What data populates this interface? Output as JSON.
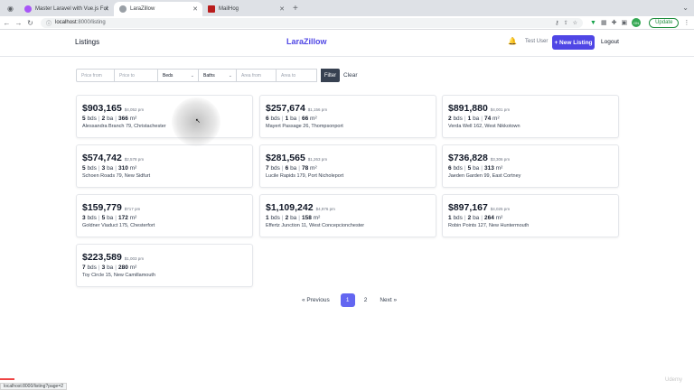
{
  "browser": {
    "tabs": [
      {
        "label": "Master Laravel with Vue.js Ful",
        "color": "#a855f7",
        "active": false
      },
      {
        "label": "LaraZillow",
        "color": "#5f6368",
        "active": true
      },
      {
        "label": "MailHog",
        "color": "#b91c1c",
        "active": false
      }
    ],
    "new_tab": "+",
    "url_host": "localhost",
    "url_path": ":8000/listing",
    "update_label": "Update",
    "profile_initials": "GN"
  },
  "header": {
    "listings_link": "Listings",
    "brand": "LaraZillow",
    "user_name": "Test User",
    "new_listing": "+ New Listing",
    "logout": "Logout"
  },
  "filters": {
    "price_from_placeholder": "Price from",
    "price_to_placeholder": "Price to",
    "beds_label": "Beds",
    "baths_label": "Baths",
    "area_from_placeholder": "Area from",
    "area_to_placeholder": "Area to",
    "filter_button": "Filter",
    "clear_button": "Clear"
  },
  "listings": [
    {
      "price": "$903,165",
      "monthly": "$4,052 pm",
      "beds": "5",
      "baths": "2",
      "area": "366",
      "address": "Alessandra Branch 79, Christachester"
    },
    {
      "price": "$257,674",
      "monthly": "$1,156 pm",
      "beds": "6",
      "baths": "1",
      "area": "66",
      "address": "Mayert Passage 26, Thompsonport"
    },
    {
      "price": "$891,880",
      "monthly": "$4,001 pm",
      "beds": "2",
      "baths": "1",
      "area": "74",
      "address": "Verda Well 162, West Nikkotown"
    },
    {
      "price": "$574,742",
      "monthly": "$2,578 pm",
      "beds": "5",
      "baths": "3",
      "area": "310",
      "address": "Schoen Roads 79, New Sidfurt"
    },
    {
      "price": "$281,565",
      "monthly": "$1,263 pm",
      "beds": "7",
      "baths": "6",
      "area": "78",
      "address": "Lucile Rapids 179, Port Nicholeport"
    },
    {
      "price": "$736,828",
      "monthly": "$3,306 pm",
      "beds": "6",
      "baths": "5",
      "area": "313",
      "address": "Jaeden Garden 99, East Cortney"
    },
    {
      "price": "$159,779",
      "monthly": "$717 pm",
      "beds": "3",
      "baths": "5",
      "area": "172",
      "address": "Goldner Viaduct 175, Chesterfort"
    },
    {
      "price": "$1,109,242",
      "monthly": "$4,976 pm",
      "beds": "1",
      "baths": "2",
      "area": "158",
      "address": "Effertz Junction 11, West Concepcionchester"
    },
    {
      "price": "$897,167",
      "monthly": "$4,025 pm",
      "beds": "1",
      "baths": "2",
      "area": "264",
      "address": "Robin Points 127, New Huntermouth"
    },
    {
      "price": "$223,589",
      "monthly": "$1,003 pm",
      "beds": "7",
      "baths": "3",
      "area": "280",
      "address": "Toy Circle 15, New Camillamouth"
    }
  ],
  "units": {
    "beds": "bds",
    "baths": "ba",
    "area": "m²"
  },
  "pagination": {
    "previous": "« Previous",
    "pages": [
      "1",
      "2"
    ],
    "current": "1",
    "next": "Next »"
  },
  "statusbar": {
    "link": "localhost:8000/listing?page=2"
  },
  "watermark": "Udemy",
  "colors": {
    "brand": "#4f46e5",
    "active_page": "#6366f1",
    "filter_button": "#374151"
  }
}
